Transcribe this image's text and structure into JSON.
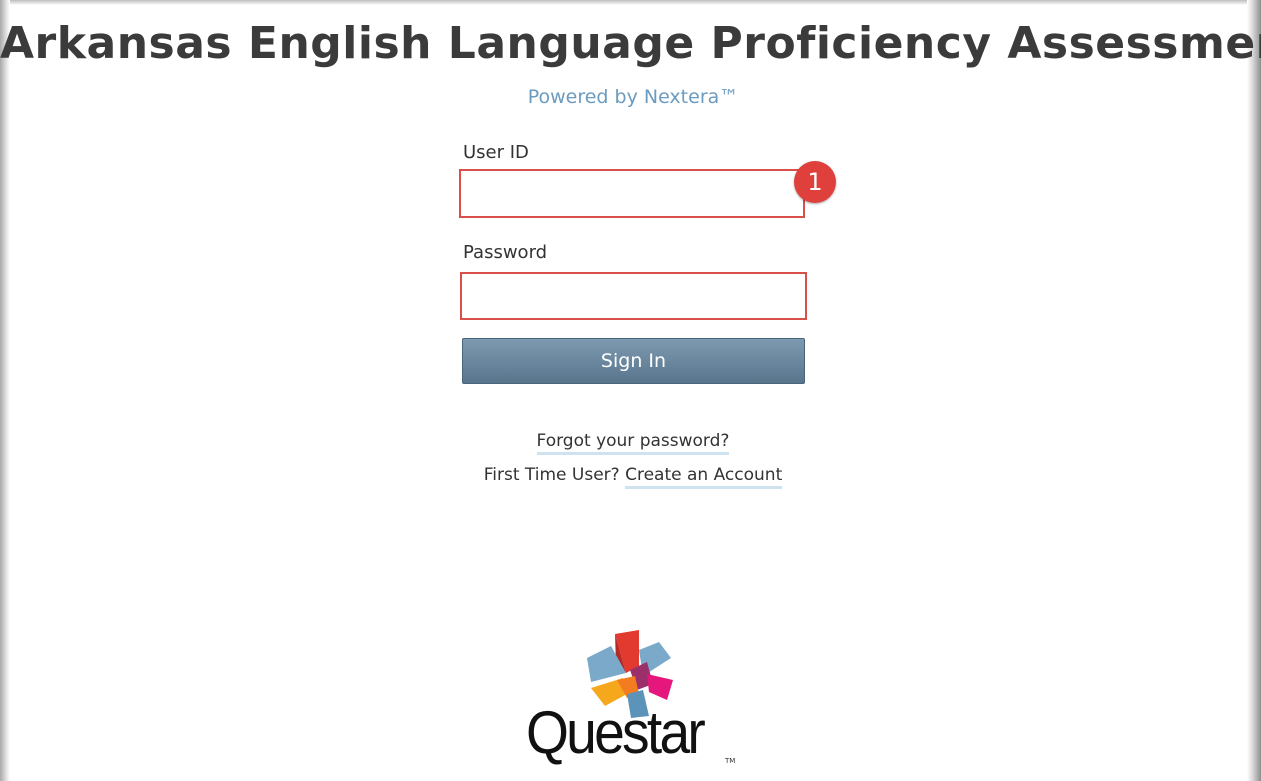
{
  "header": {
    "title": "Arkansas English Language Proficiency Assessment",
    "subtitle": "Powered by Nextera™"
  },
  "form": {
    "user_id_label": "User ID",
    "user_id_value": "",
    "password_label": "Password",
    "password_value": "",
    "sign_in_label": "Sign In",
    "callout_number": "1"
  },
  "links": {
    "forgot_password": "Forgot your password?",
    "first_time_prefix": "First Time User?",
    "create_account": "Create an Account"
  },
  "logo": {
    "wordmark": "Questar",
    "trademark": "TM",
    "colors": [
      "#e23a2e",
      "#7aa9c9",
      "#9b2f6a",
      "#e5177d",
      "#f6a81c",
      "#f37b20",
      "#5c93b8"
    ]
  },
  "colors": {
    "highlight_border": "#d9504a",
    "callout_bg": "#e0403b",
    "button_top": "#7e9ab1",
    "button_bottom": "#58758d",
    "subtitle": "#6b9bbf"
  }
}
